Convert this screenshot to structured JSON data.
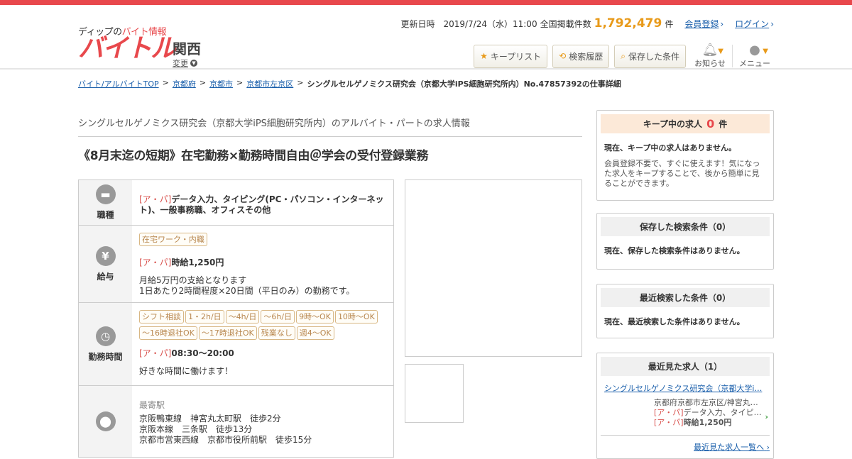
{
  "header": {
    "logo_sub_prefix": "ディップの",
    "logo_sub_accent": "バイト情報",
    "logo_main": "バイトル",
    "region": "関西",
    "region_change": "変更",
    "updated_label": "更新日時",
    "updated_value": "2019/7/24（水）11:00",
    "count_label": "全国掲載件数",
    "count_value": "1,792,479",
    "count_unit": "件",
    "register_link": "会員登録",
    "login_link": "ログイン",
    "buttons": {
      "keep_list": "キープリスト",
      "search_history": "検索履歴",
      "saved_conditions": "保存した条件"
    },
    "notify_label": "お知らせ",
    "menu_label": "メニュー"
  },
  "breadcrumb": {
    "items": [
      "バイト/アルバイトTOP",
      "京都府",
      "京都市",
      "京都市左京区"
    ],
    "current": "シングルセルゲノミクス研究会（京都大学iPS細胞研究所内）No.47857392の仕事詳細"
  },
  "job": {
    "company": "シングルセルゲノミクス研究会（京都大学iPS細胞研究所内）のアルバイト・パートの求人情報",
    "title": "《8月末迄の短期》在宅勤務×勤務時間自由＠学会の受付登録業務",
    "ap_tag": "[ア・パ]",
    "occupation_label": "職種",
    "occupation": "データ入力、タイピング(PC・パソコン・インターネット)、一般事務職、オフィスその他",
    "salary_label": "給与",
    "salary_tag": "在宅ワーク・内職",
    "salary": "時給1,250円",
    "salary_note_1": "月給5万円の支給となります",
    "salary_note_2": "1日あたり2時間程度×20日間（平日のみ）の勤務です。",
    "hours_label": "勤務時間",
    "hours_tags": [
      "シフト相談",
      "1・2h/日",
      "～4h/日",
      "～6h/日",
      "9時～OK",
      "10時～OK",
      "～16時退社OK",
      "～17時退社OK",
      "残業なし",
      "週4〜OK"
    ],
    "hours": "08:30～20:00",
    "hours_note": "好きな時間に働けます！",
    "station_heading": "最寄駅",
    "stations": [
      "京阪鴨東線　神宮丸太町駅　徒歩2分",
      "京阪本線　三条駅　徒歩13分",
      "京都市営東西線　京都市役所前駅　徒歩15分"
    ]
  },
  "sidebar": {
    "keep_title": "キープ中の求人",
    "keep_count": "0",
    "keep_unit": "件",
    "keep_empty": "現在、キープ中の求人はありません。",
    "keep_note": "会員登録不要で、すぐに使えます！気になった求人をキープすることで、後から簡単に見ることができます。",
    "saved_title": "保存した検索条件（0）",
    "saved_empty": "現在、保存した検索条件はありません。",
    "recent_search_title": "最近検索した条件（0）",
    "recent_search_empty": "現在、最近検索した条件はありません。",
    "recent_viewed_title": "最近見た求人（1）",
    "recent_viewed_link": "シングルセルゲノミクス研究会（京都大学i…",
    "recent_viewed_location": "京都府京都市左京区/神宮丸…",
    "recent_viewed_job": "データ入力、タイピ…",
    "recent_viewed_salary": "時給1,250円",
    "recent_viewed_all": "最近見た求人一覧へ"
  }
}
